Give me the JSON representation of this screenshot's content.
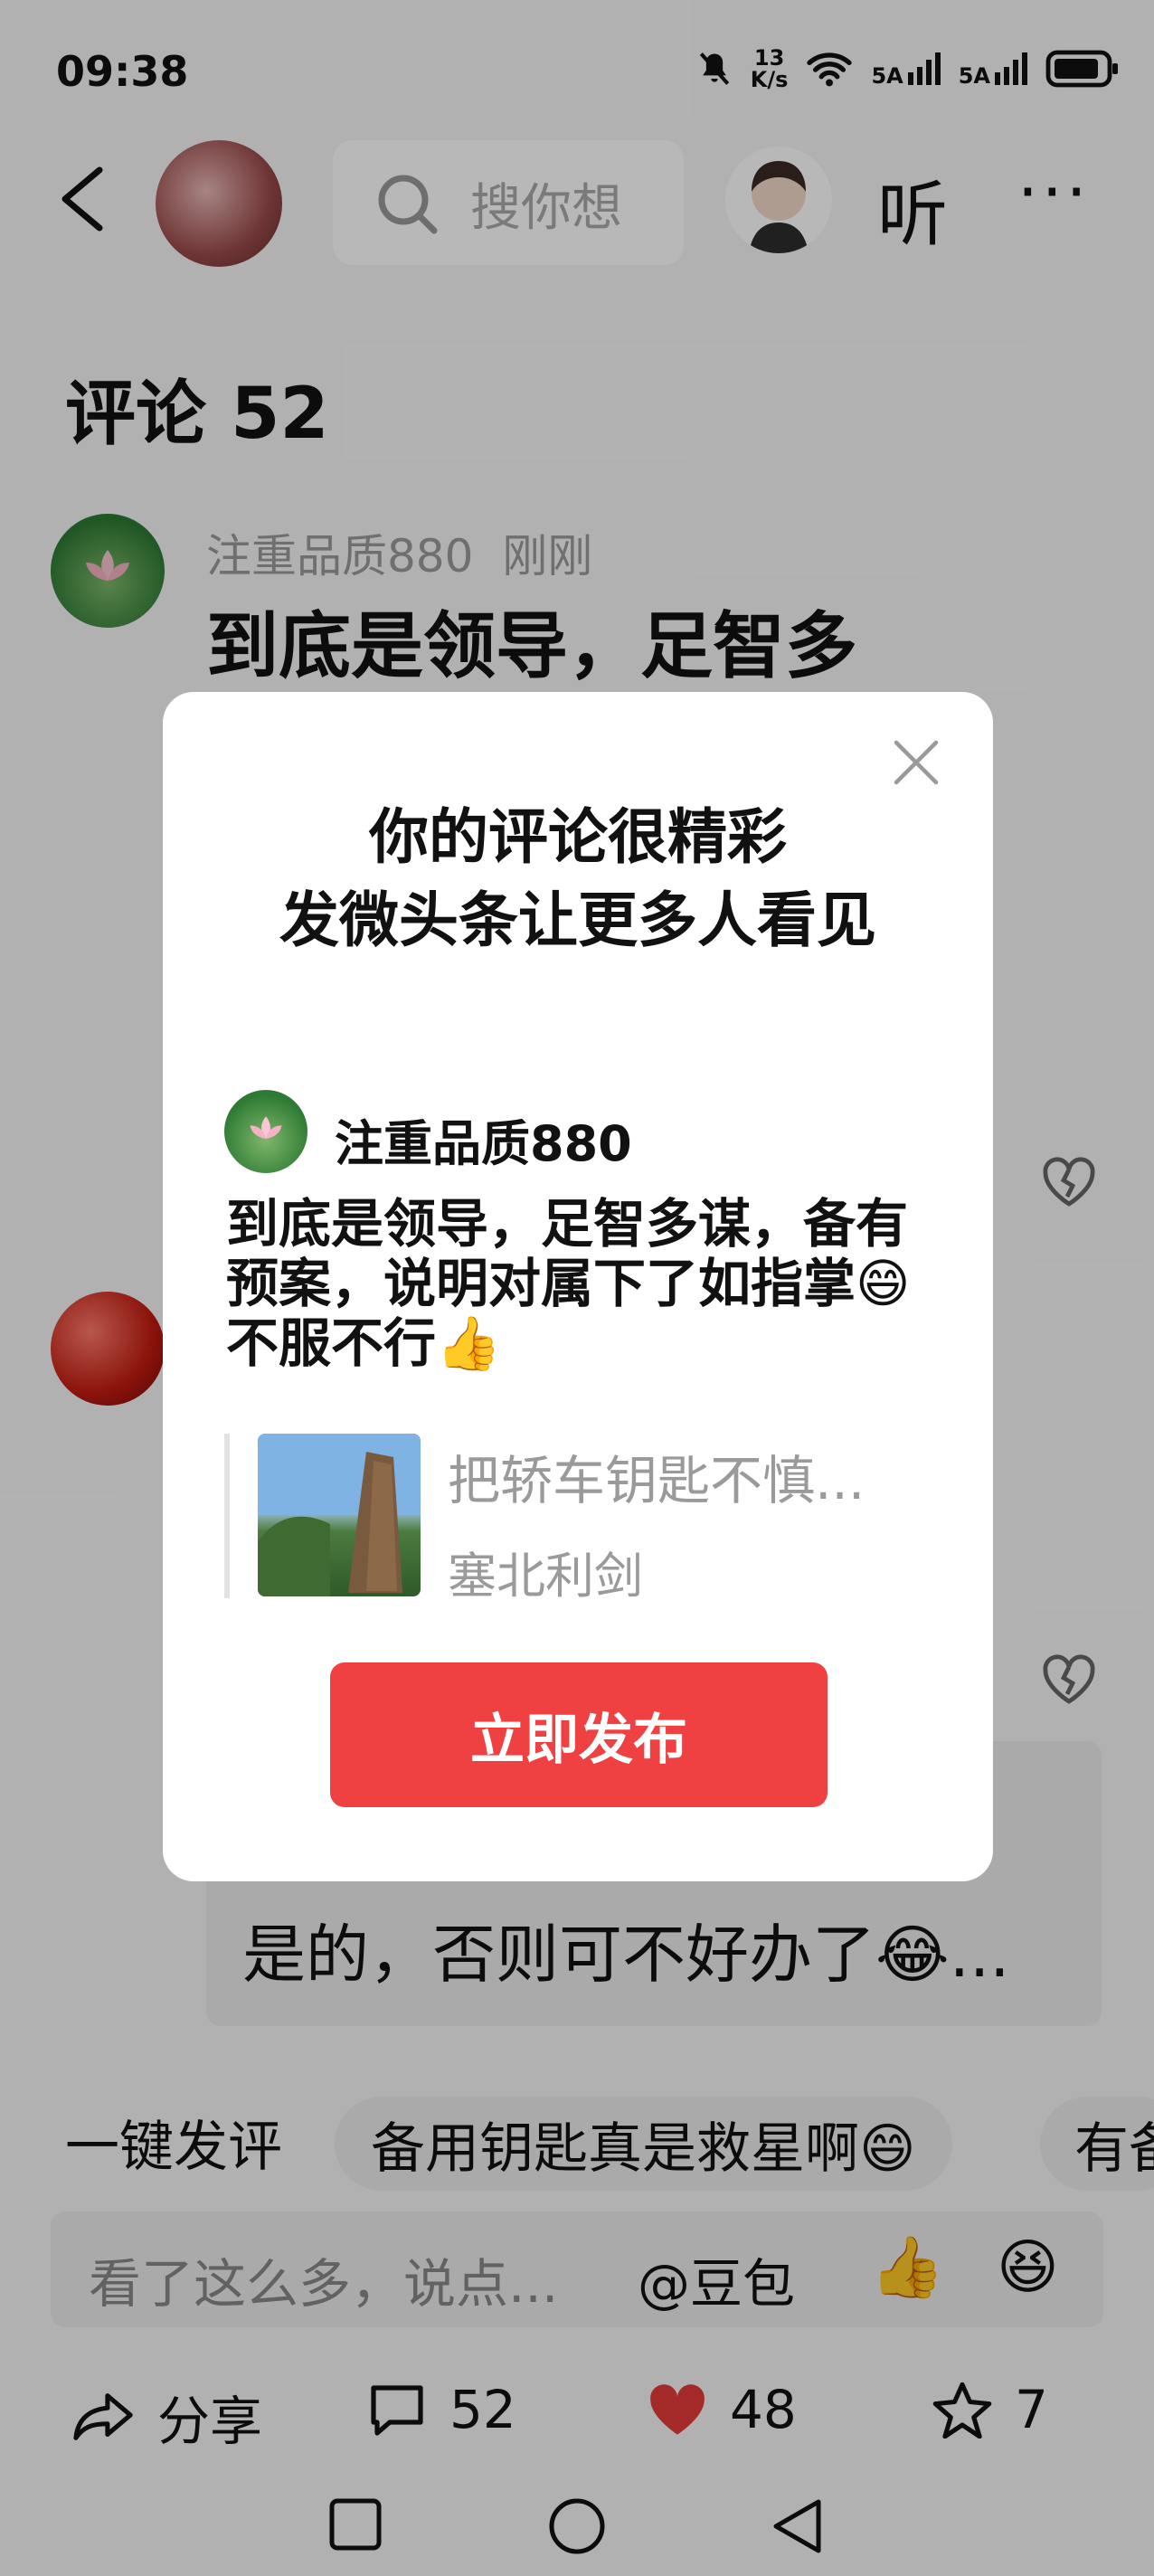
{
  "status_bar": {
    "time": "09:38",
    "net_speed_top": "13",
    "net_speed_unit": "K/s",
    "sig1_label": "5A",
    "sig2_label": "5A"
  },
  "header": {
    "search_placeholder": "搜你想",
    "listen_label": "听",
    "more_label": "···"
  },
  "comments": {
    "title": "评论 52",
    "first": {
      "author": "注重品质880",
      "time": "刚刚",
      "text_visible": "到底是领导，足智多"
    },
    "reply_text": "是的，否则可不好办了😂..."
  },
  "quick_reply": {
    "label": "一键发评",
    "chips": [
      "备用钥匙真是救星啊😄",
      "有备"
    ]
  },
  "input_bar": {
    "placeholder": "看了这么多，说点...",
    "mention": "@豆包",
    "emoji1": "👍",
    "emoji2": "😆"
  },
  "actions": {
    "share": "分享",
    "comments_count": "52",
    "likes_count": "48",
    "favorites_count": "7"
  },
  "modal": {
    "title_line1": "你的评论很精彩",
    "title_line2": "发微头条让更多人看见",
    "author": "注重品质880",
    "comment_text": "到底是领导，足智多谋，备有预案，说明对属下了如指掌😄不服不行👍",
    "quote_title": "把轿车钥匙不慎...",
    "quote_author": "塞北利剑",
    "publish_label": "立即发布"
  },
  "colors": {
    "accent_red": "#f04142",
    "like_red": "#e33b3b"
  }
}
